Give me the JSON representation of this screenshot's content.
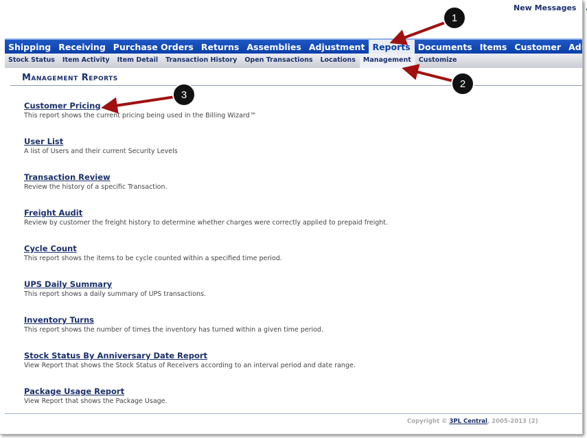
{
  "top": {
    "new_messages": "New Messages",
    "cut_link": "A"
  },
  "nav": [
    "Shipping",
    "Receiving",
    "Purchase Orders",
    "Returns",
    "Assemblies",
    "Adjustment",
    "Reports",
    "Documents",
    "Items",
    "Customer",
    "Admin"
  ],
  "nav_active": "Reports",
  "subnav": [
    "Stock Status",
    "Item Activity",
    "Item Detail",
    "Transaction History",
    "Open Transactions",
    "Locations",
    "Management",
    "Customize"
  ],
  "subnav_active": "Management",
  "page_title": "Management Reports",
  "reports": [
    {
      "title": "Customer Pricing",
      "desc": "This report shows the current pricing being used in the Billing Wizard™"
    },
    {
      "title": "User List",
      "desc": "A list of Users and their current Security Levels"
    },
    {
      "title": "Transaction Review",
      "desc": "Review the history of a specific Transaction."
    },
    {
      "title": "Freight Audit",
      "desc": "Review by customer the freight history to determine whether charges were correctly applied to prepaid freight."
    },
    {
      "title": "Cycle Count",
      "desc": "This report shows the items to be cycle counted within a specified time period."
    },
    {
      "title": "UPS Daily Summary",
      "desc": "This report shows a daily summary of UPS transactions."
    },
    {
      "title": "Inventory Turns",
      "desc": "This report shows the number of times the inventory has turned within a given time period."
    },
    {
      "title": "Stock Status By Anniversary Date Report",
      "desc": "View Report that shows the Stock Status of Receivers according to an interval period and date range."
    },
    {
      "title": "Package Usage Report",
      "desc": "View Report that shows the Package Usage."
    }
  ],
  "footer": {
    "prefix": "Copyright © ",
    "link": "3PL Central",
    "suffix": ", 2005-2013 (2)"
  },
  "annotations": [
    "1",
    "2",
    "3"
  ],
  "colors": {
    "nav": "#0a3ea8",
    "arrow": "#a01010",
    "link": "#1a2f6b"
  }
}
